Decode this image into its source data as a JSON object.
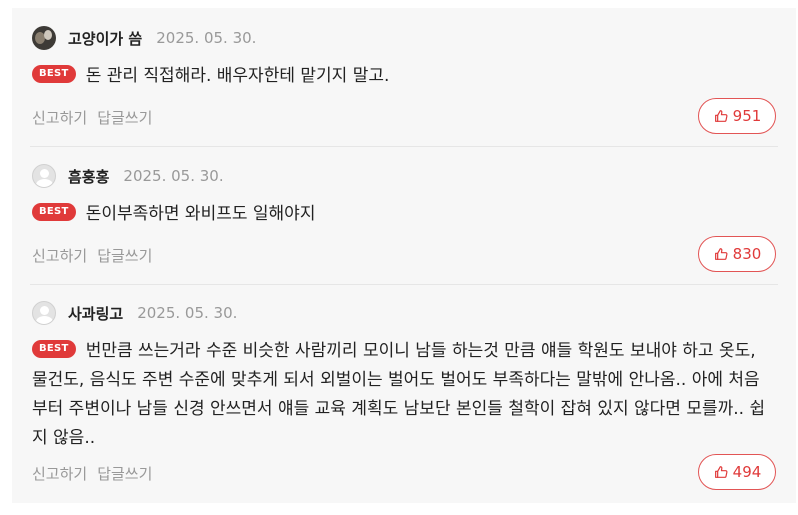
{
  "comments": [
    {
      "username": "고양이가 씀",
      "date": "2025. 05. 30.",
      "badge": "BEST",
      "text": "돈 관리 직접해라. 배우자한테 맡기지 말고.",
      "report_label": "신고하기",
      "reply_label": "답글쓰기",
      "likes": "951",
      "avatar": "photo"
    },
    {
      "username": "흠훙홍",
      "date": "2025. 05. 30.",
      "badge": "BEST",
      "text": "돈이부족하면 와비프도 일해야지",
      "report_label": "신고하기",
      "reply_label": "답글쓰기",
      "likes": "830",
      "avatar": "default"
    },
    {
      "username": "사과링고",
      "date": "2025. 05. 30.",
      "badge": "BEST",
      "text": "번만큼 쓰는거라 수준 비슷한 사람끼리 모이니 남들 하는것 만큼 얘들 학원도 보내야 하고 옷도, 물건도, 음식도 주변 수준에 맞추게 되서 외벌이는 벌어도 벌어도 부족하다는 말밖에 안나옴.. 아에 처음부터 주변이나 남들 신경 안쓰면서 얘들 교육 계획도 남보단 본인들 철학이 잡혀 있지 않다면 모를까.. 쉽지 않음..",
      "report_label": "신고하기",
      "reply_label": "답글쓰기",
      "likes": "494",
      "avatar": "default"
    }
  ],
  "colors": {
    "accent": "#e03a3a",
    "muted": "#999999",
    "panel_bg": "#f7f7f7"
  },
  "icons": {
    "like": "thumbs-up-icon"
  }
}
